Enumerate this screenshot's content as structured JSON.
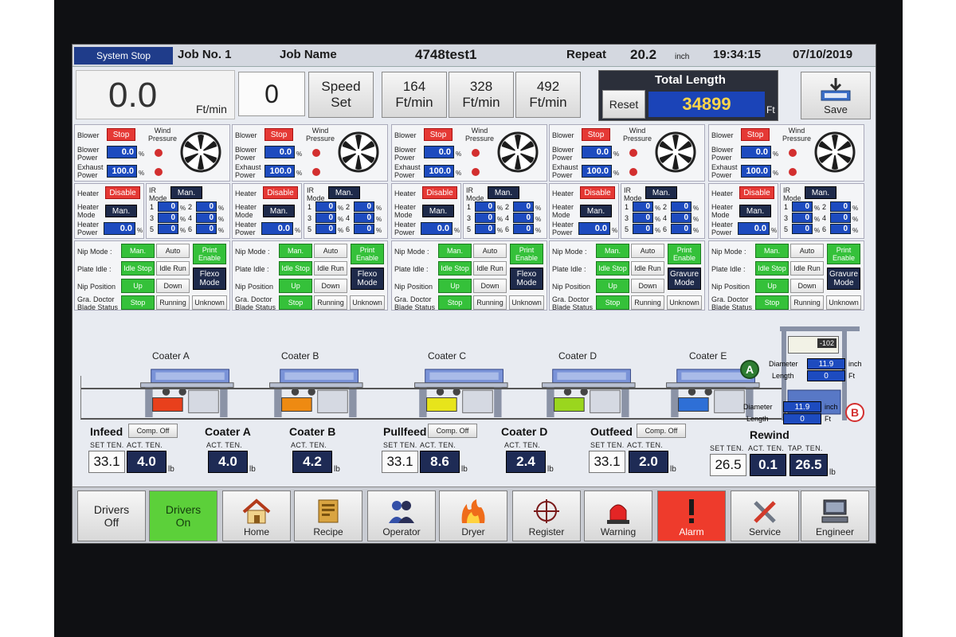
{
  "header": {
    "status": "System Stop",
    "job_no_label": "Job No. 1",
    "job_name_label": "Job Name",
    "job_name": "4748test1",
    "repeat_label": "Repeat",
    "repeat_value": "20.2",
    "repeat_unit": "inch",
    "time": "19:34:15",
    "date": "07/10/2019"
  },
  "speed": {
    "current": "0.0",
    "unit": "Ft/min",
    "setpoint": "0",
    "set_label_line1": "Speed",
    "set_label_line2": "Set",
    "presets": [
      {
        "value": "164",
        "unit": "Ft/min"
      },
      {
        "value": "328",
        "unit": "Ft/min"
      },
      {
        "value": "492",
        "unit": "Ft/min"
      }
    ]
  },
  "total": {
    "title": "Total Length",
    "reset_label": "Reset",
    "value": "34899",
    "unit": "Ft",
    "save_label": "Save"
  },
  "panel_labels": {
    "blower": "Blower",
    "wind_pressure_1": "Wind",
    "wind_pressure_2": "Pressure",
    "blower_power_1": "Blower",
    "blower_power_2": "Power",
    "exhaust_power_1": "Exhaust",
    "exhaust_power_2": "Power",
    "heater": "Heater",
    "heater_mode_1": "Heater",
    "heater_mode_2": "Mode",
    "heater_power_1": "Heater",
    "heater_power_2": "Power",
    "ir_mode_1": "IR",
    "ir_mode_2": "Mode",
    "nip_mode": "Nip Mode :",
    "plate_idle": "Plate Idle :",
    "nip_position": "Nip Position",
    "doctor_1": "Gra. Doctor",
    "doctor_2": "Blade Status",
    "pct": "%"
  },
  "panels": [
    {
      "blower_state": "Stop",
      "blower_power": "0.0",
      "exhaust_power": "100.0",
      "heater_state": "Disable",
      "heater_mode": "Man.",
      "heater_power": "0.0",
      "ir_mode": "Man.",
      "ir": [
        {
          "n": "1",
          "v": "0"
        },
        {
          "n": "2",
          "v": "0"
        },
        {
          "n": "3",
          "v": "0"
        },
        {
          "n": "4",
          "v": "0"
        },
        {
          "n": "5",
          "v": "0"
        },
        {
          "n": "6",
          "v": "0"
        }
      ],
      "nip_mode_a": "Man.",
      "nip_mode_b": "Auto",
      "plate_a": "Idle Stop",
      "plate_b": "Idle Run",
      "nip_pos_a": "Up",
      "nip_pos_b": "Down",
      "blade_a": "Stop",
      "blade_b": "Running",
      "blade_c": "Unknown",
      "print_enable_1": "Print",
      "print_enable_2": "Enable",
      "mode_1": "Flexo",
      "mode_2": "Mode"
    },
    {
      "blower_state": "Stop",
      "blower_power": "0.0",
      "exhaust_power": "100.0",
      "heater_state": "Disable",
      "heater_mode": "Man.",
      "heater_power": "0.0",
      "ir_mode": "Man.",
      "ir": [
        {
          "n": "1",
          "v": "0"
        },
        {
          "n": "2",
          "v": "0"
        },
        {
          "n": "3",
          "v": "0"
        },
        {
          "n": "4",
          "v": "0"
        },
        {
          "n": "5",
          "v": "0"
        },
        {
          "n": "6",
          "v": "0"
        }
      ],
      "nip_mode_a": "Man.",
      "nip_mode_b": "Auto",
      "plate_a": "Idle Stop",
      "plate_b": "Idle Run",
      "nip_pos_a": "Up",
      "nip_pos_b": "Down",
      "blade_a": "Stop",
      "blade_b": "Running",
      "blade_c": "Unknown",
      "print_enable_1": "Print",
      "print_enable_2": "Enable",
      "mode_1": "Flexo",
      "mode_2": "Mode"
    },
    {
      "blower_state": "Stop",
      "blower_power": "0.0",
      "exhaust_power": "100.0",
      "heater_state": "Disable",
      "heater_mode": "Man.",
      "heater_power": "0.0",
      "ir_mode": "Man.",
      "ir": [
        {
          "n": "1",
          "v": "0"
        },
        {
          "n": "2",
          "v": "0"
        },
        {
          "n": "3",
          "v": "0"
        },
        {
          "n": "4",
          "v": "0"
        },
        {
          "n": "5",
          "v": "0"
        },
        {
          "n": "6",
          "v": "0"
        }
      ],
      "nip_mode_a": "Man.",
      "nip_mode_b": "Auto",
      "plate_a": "Idle Stop",
      "plate_b": "Idle Run",
      "nip_pos_a": "Up",
      "nip_pos_b": "Down",
      "blade_a": "Stop",
      "blade_b": "Running",
      "blade_c": "Unknown",
      "print_enable_1": "Print",
      "print_enable_2": "Enable",
      "mode_1": "Flexo",
      "mode_2": "Mode"
    },
    {
      "blower_state": "Stop",
      "blower_power": "0.0",
      "exhaust_power": "100.0",
      "heater_state": "Disable",
      "heater_mode": "Man.",
      "heater_power": "0.0",
      "ir_mode": "Man.",
      "ir": [
        {
          "n": "1",
          "v": "0"
        },
        {
          "n": "2",
          "v": "0"
        },
        {
          "n": "3",
          "v": "0"
        },
        {
          "n": "4",
          "v": "0"
        },
        {
          "n": "5",
          "v": "0"
        },
        {
          "n": "6",
          "v": "0"
        }
      ],
      "nip_mode_a": "Man.",
      "nip_mode_b": "Auto",
      "plate_a": "Idle Stop",
      "plate_b": "Idle Run",
      "nip_pos_a": "Up",
      "nip_pos_b": "Down",
      "blade_a": "Stop",
      "blade_b": "Running",
      "blade_c": "Unknown",
      "print_enable_1": "Print",
      "print_enable_2": "Enable",
      "mode_1": "Gravure",
      "mode_2": "Mode"
    },
    {
      "blower_state": "Stop",
      "blower_power": "0.0",
      "exhaust_power": "100.0",
      "heater_state": "Disable",
      "heater_mode": "Man.",
      "heater_power": "0.0",
      "ir_mode": "Man.",
      "ir": [
        {
          "n": "1",
          "v": "0"
        },
        {
          "n": "2",
          "v": "0"
        },
        {
          "n": "3",
          "v": "0"
        },
        {
          "n": "4",
          "v": "0"
        },
        {
          "n": "5",
          "v": "0"
        },
        {
          "n": "6",
          "v": "0"
        }
      ],
      "nip_mode_a": "Man.",
      "nip_mode_b": "Auto",
      "plate_a": "Idle Stop",
      "plate_b": "Idle Run",
      "nip_pos_a": "Up",
      "nip_pos_b": "Down",
      "blade_a": "Stop",
      "blade_b": "Running",
      "blade_c": "Unknown",
      "print_enable_1": "Print",
      "print_enable_2": "Enable",
      "mode_1": "Gravure",
      "mode_2": "Mode"
    }
  ],
  "coaters": {
    "labels": [
      "Coater A",
      "Coater B",
      "Coater C",
      "Coater D",
      "Coater E"
    ],
    "colors": [
      "#e8401c",
      "#ee8a12",
      "#e7e41b",
      "#9ad61e",
      "#2e6fd6"
    ]
  },
  "unwind": {
    "meter": "-102",
    "tag_a": "A",
    "tag_b": "B",
    "diameter_label": "Diameter",
    "length_label": "Length",
    "a_diameter": "11.9",
    "a_length": "0",
    "b_diameter": "11.9",
    "b_length": "0",
    "inch": "inch",
    "ft": "Ft"
  },
  "tension": {
    "set_ten": "SET TEN.",
    "act_ten": "ACT. TEN.",
    "tap_ten": "TAP. TEN.",
    "unit": "lb",
    "comp_off": "Comp. Off",
    "infeed": {
      "title": "Infeed",
      "set": "33.1",
      "act": "4.0"
    },
    "coater_a": {
      "title": "Coater A",
      "act": "4.0"
    },
    "coater_b": {
      "title": "Coater B",
      "act": "4.2"
    },
    "pullfeed": {
      "title": "Pullfeed",
      "set": "33.1",
      "act": "8.6"
    },
    "coater_d": {
      "title": "Coater D",
      "act": "2.4"
    },
    "outfeed": {
      "title": "Outfeed",
      "set": "33.1",
      "act": "2.0"
    },
    "rewind": {
      "title": "Rewind",
      "set": "26.5",
      "act": "0.1",
      "tap": "26.5"
    }
  },
  "nav": {
    "drivers_off_1": "Drivers",
    "drivers_off_2": "Off",
    "drivers_on_1": "Drivers",
    "drivers_on_2": "On",
    "home": "Home",
    "recipe": "Recipe",
    "operator": "Operator",
    "dryer": "Dryer",
    "register": "Register",
    "warning": "Warning",
    "alarm": "Alarm",
    "service": "Service",
    "engineer": "Engineer",
    "colors": {
      "drivers_on": "#5cd03a",
      "alarm": "#ee3b2c"
    }
  }
}
